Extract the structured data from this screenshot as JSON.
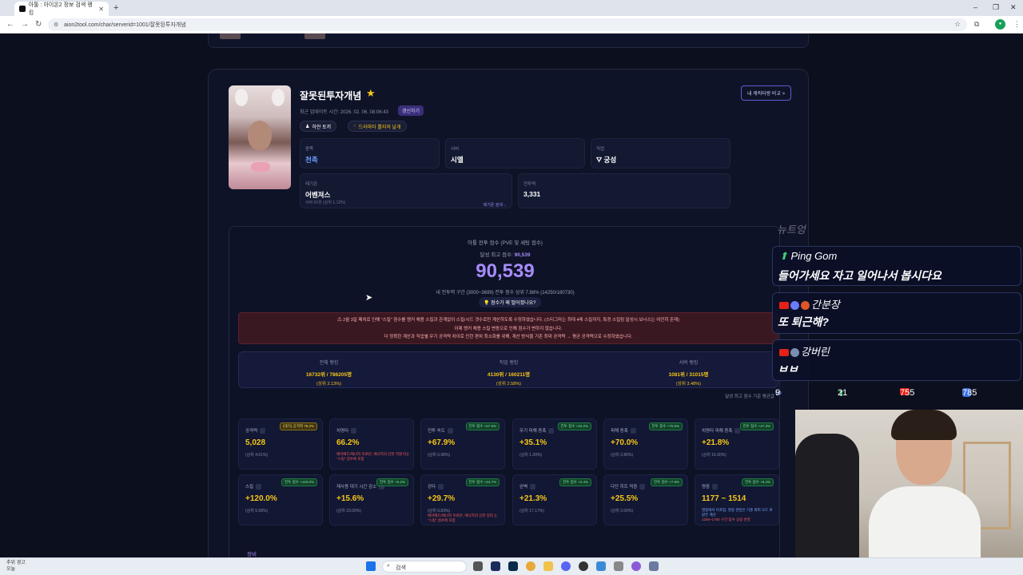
{
  "browser": {
    "tab_title": "아툴 : 아이온2 정보 검색 랭킹",
    "tab_close": "✕",
    "new_tab": "+",
    "url": "aion2tool.com/char/serverid=1001/잘못된투자개념",
    "minimize": "–",
    "maximize": "❐",
    "close": "✕"
  },
  "character": {
    "name": "잘못된투자개념",
    "last_update": "최근 업데이트 시간: 2026. 02. 06. 08:06:43",
    "refresh_label": "갱신하기",
    "tag_1": "하얀 토끼",
    "tag_2": "드라마타 뿔지의 날개",
    "compare_label": "내 캐릭터랑 비교 >",
    "race_label": "종족",
    "race_value": "천족",
    "server_label": "서버",
    "server_value": "시엘",
    "class_label": "직업",
    "class_value": "궁성",
    "legion_label": "레기온",
    "legion_value": "어벤져스",
    "legion_sub": "서버 61위 (상위 1.12%)",
    "legion_link": "레기온 검색→",
    "power_label": "전투력",
    "power_value": "3,331"
  },
  "score": {
    "title": "아툴 전투 점수 (PVE 및 세팅 점수)",
    "best_prefix": "달성 최고 점수: ",
    "best_value": "90,539",
    "big_value": "90,539",
    "range_line": "내 전투력 구간 (3000~3699) 전투 점수 상위 7.88% (14250/180730)",
    "hint": "점수가 왜 떨어졌나요?",
    "notice_1": "⚠ 2월 3일 패치로 인해 \"스킬\" 점수를 랭커 채용 스킬과 관계없이 스킬/시드 갯수로만 계산하도록 수정하였습니다. (스티그마는 최대 4레 스킬까지, 특정 스킬링 달성시 보너스는 여전히 존재)",
    "notice_2": "이제 랭커 채용 스킬 변동으로 인해 점수가 변하지 않습니다.",
    "notice_3": "더 정확한 계산과 직업별 무기 공격력 차이로 인한 편차 최소화를 위해, 계산 방식을 기존 최대 공격력 → 평균 공격력으로 수정하였습니다.",
    "basis": "달성 최고 점수 기준 평균값"
  },
  "ranks": [
    {
      "label": "전체 랭킹",
      "value": "16732위 / 786205명",
      "pct": "(상위 2.13%)"
    },
    {
      "label": "직업 랭킹",
      "value": "4130위 / 160211명",
      "pct": "(상위 2.58%)"
    },
    {
      "label": "서버 랭킹",
      "value": "1081위 / 31015명",
      "pct": "(상위 3.48%)"
    }
  ],
  "stats": [
    {
      "label": "공격력",
      "value": "5,028",
      "rank": "(상위 4.61%)",
      "badge": "(대기) 공격력 78.2%"
    },
    {
      "label": "치명타",
      "value": "66.2%",
      "warn": "에이메드/에너지 이로만, 에너지의 인한 치명 타는 \"스킬\" 점수에 포함"
    },
    {
      "label": "전투 속도",
      "value": "+67.9%",
      "rank": "(상위 0.98%)",
      "badge": "전투 점수 +67.9%"
    },
    {
      "label": "무기 피해 증폭",
      "value": "+35.1%",
      "rank": "(상위 1.30%)",
      "badge": "전투 점수 +23.2%"
    },
    {
      "label": "피해 증폭",
      "value": "+70.0%",
      "rank": "(상위 2.86%)",
      "badge": "전투 점수 +70.6%"
    },
    {
      "label": "치명타 피해 증폭",
      "value": "+21.8%",
      "rank": "(상위 16.00%)",
      "badge": "전투 점수 +47.3%"
    },
    {
      "label": "스킬",
      "value": "+120.0%",
      "rank": "(상위 5.58%)",
      "badge": "전투 점수 +120.0%"
    },
    {
      "label": "재사용 대기 시간 감소",
      "value": "+15.6%",
      "rank": "(상위 23.00%)",
      "badge": "전투 점수 +5.2%"
    },
    {
      "label": "강타",
      "value": "+29.7%",
      "rank": "(상위 0.83%)",
      "warn": "에이메드/에너지 이로만, 에너지의 인한 강타 는 \"스킬\" 점수에 포함",
      "badge": "전투 점수 +24.7%"
    },
    {
      "label": "완벽",
      "value": "+21.3%",
      "rank": "(상위 17.17%)",
      "badge": "전투 점수 +2.4%"
    },
    {
      "label": "다단 히트 적중",
      "value": "+25.5%",
      "rank": "(상위 2.00%)",
      "badge": "전투 점수 +7.9%"
    },
    {
      "label": "명중",
      "value": "1177 ~ 1514",
      "note": "명중에서 미포함, 명중 관련은 기준 회피 모드 로 같은 계산",
      "warn": "1200~1700 구간 점수 상승 반영",
      "badge": "전투 점수 +9.4%"
    }
  ],
  "section_next": "장비",
  "overlay": {
    "ghost": "뉴트엉",
    "chat": [
      {
        "user": "Ping Gom",
        "msg": "들어가세요 자고 일어나서 봅시다요"
      },
      {
        "user": "간분장",
        "msg": "또 퇴근해?"
      },
      {
        "user": "강버린",
        "msg": "ㅂㅂ"
      }
    ],
    "counts": [
      "9",
      "21",
      "755",
      "785"
    ]
  },
  "taskbar": {
    "weather_1": "추위 경고",
    "weather_2": "오늘",
    "search_placeholder": "검색"
  },
  "colors": {
    "accent": "#a78bfa",
    "gold": "#f5c518",
    "background": "#0c0f1e"
  }
}
